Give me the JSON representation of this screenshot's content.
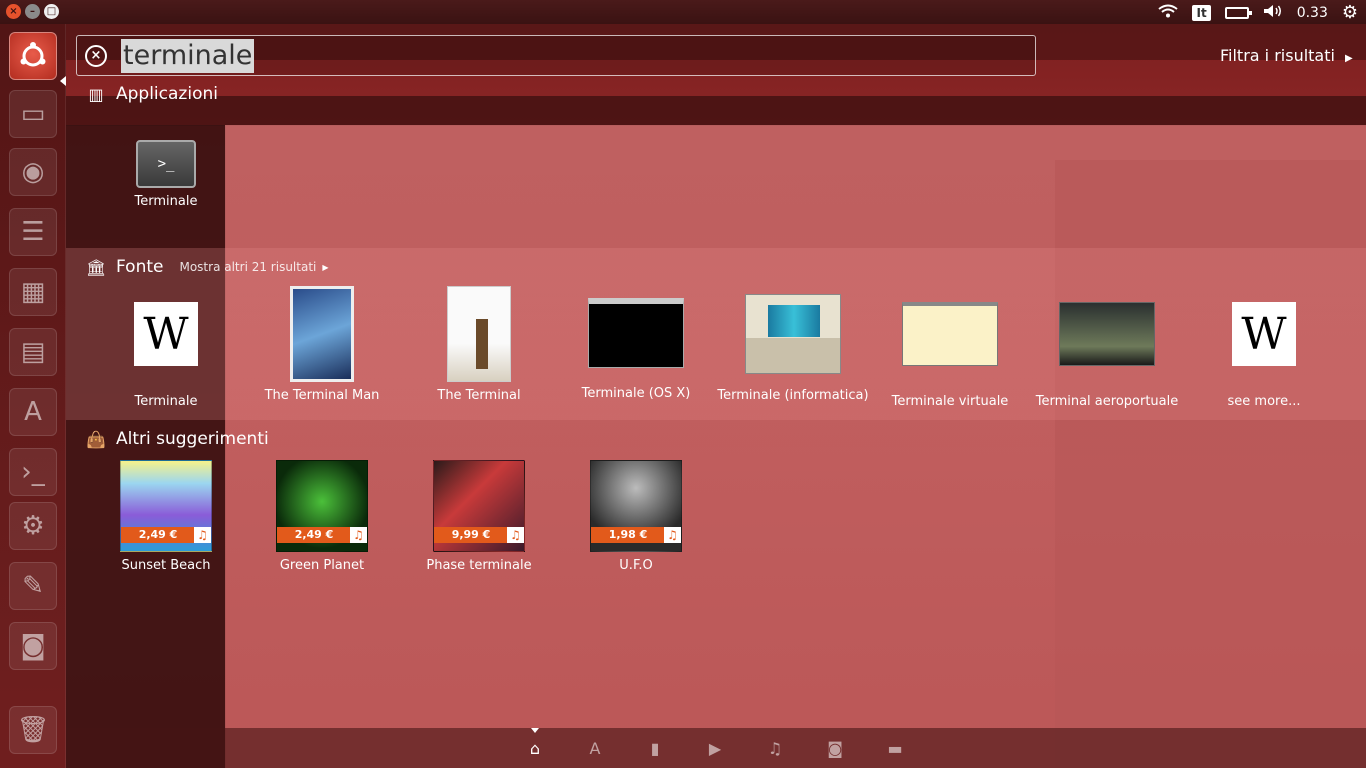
{
  "panel": {
    "window_buttons": [
      "close",
      "minimize",
      "maximize"
    ],
    "indicators": {
      "network": "wifi-icon",
      "keyboard_layout": "It",
      "battery": "battery-icon",
      "volume": "volume-icon",
      "clock": "0.33",
      "session": "gear-icon"
    }
  },
  "search": {
    "query": "terminale",
    "filter_label": "Filtra i risultati"
  },
  "categories": {
    "apps": {
      "title": "Applicazioni",
      "items": [
        {
          "label": "Terminale"
        }
      ]
    },
    "sources": {
      "title": "Fonte",
      "more": "Mostra altri 21 risultati",
      "items": [
        {
          "label": "Terminale"
        },
        {
          "label": "The Terminal Man"
        },
        {
          "label": "The Terminal"
        },
        {
          "label": "Terminale (OS X)"
        },
        {
          "label": "Terminale (informatica)"
        },
        {
          "label": "Terminale virtuale"
        },
        {
          "label": "Terminal aeroportuale"
        },
        {
          "label": "see more..."
        }
      ]
    },
    "suggestions": {
      "title": "Altri suggerimenti",
      "items": [
        {
          "label": "Sunset Beach",
          "price": "2,49 €"
        },
        {
          "label": "Green Planet",
          "price": "2,49 €"
        },
        {
          "label": "Phase terminale",
          "price": "9,99 €"
        },
        {
          "label": "U.F.O",
          "price": "1,98 €"
        }
      ]
    }
  },
  "lenses": [
    "home-lens-icon",
    "applications-lens-icon",
    "files-lens-icon",
    "video-lens-icon",
    "music-lens-icon",
    "photo-lens-icon",
    "social-lens-icon"
  ],
  "colors": {
    "accent": "#e25a1b",
    "panel": "#3a1212"
  }
}
